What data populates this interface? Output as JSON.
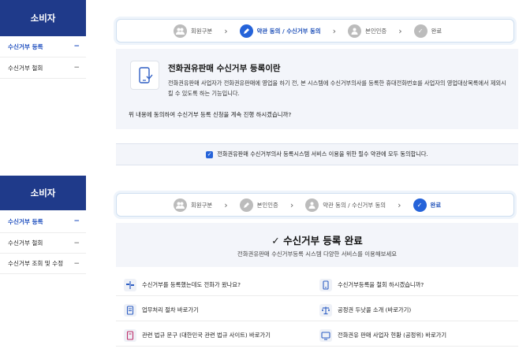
{
  "colors": {
    "brand": "#1f3a8a",
    "accent": "#2563d9",
    "panel": "#f3f5fa"
  },
  "top": {
    "sidebar": {
      "title": "소비자",
      "items": [
        {
          "label": "수신거부 등록",
          "marker": "−",
          "active": true
        },
        {
          "label": "수신거부 철회",
          "marker": "−",
          "active": false
        }
      ]
    },
    "steps": [
      {
        "label": "회원구분",
        "icon": "users-icon"
      },
      {
        "label": "약관 동의 / 수신거부 동의",
        "icon": "pencil-icon",
        "active": true
      },
      {
        "label": "본인인증",
        "icon": "person-icon"
      },
      {
        "label": "완료",
        "icon": "check-icon"
      }
    ],
    "intro": {
      "icon": "phone-icon",
      "title": "전화권유판매 수신거부 등록이란",
      "desc": "전화권유판매 사업자가 전화권유판매에 영업을 하기 전, 본 시스템에 수신거부의사를 등록한 휴대전화번호를 사업자의 영업대상목록에서 제외시킬 수 있도록 하는 기능입니다.",
      "question": "위 내용에 동의하여 수신거부 등록 신청을 계속 진행 하시겠습니까?"
    },
    "agree_label": "전화권유판매 수신거부의사 등록시스템 서비스 이용을 위한 필수 약관에 모두 동의합니다."
  },
  "bottom": {
    "sidebar": {
      "title": "소비자",
      "items": [
        {
          "label": "수신거부 등록",
          "marker": "−",
          "active": true
        },
        {
          "label": "수신거부 철회",
          "marker": "−",
          "active": false
        },
        {
          "label": "수신거부 조회 및 수정",
          "marker": "−",
          "active": false
        }
      ]
    },
    "steps": [
      {
        "label": "회원구분",
        "icon": "users-icon"
      },
      {
        "label": "본인인증",
        "icon": "pencil-icon"
      },
      {
        "label": "약관 동의 / 수신거부 동의",
        "icon": "person-icon"
      },
      {
        "label": "완료",
        "icon": "check-icon",
        "active": true
      }
    ],
    "done": {
      "title": "수신거부 등록 완료",
      "subtitle": "전화권유판매 수신거부등록 시스템 다양한 서비스를 이용해보세요"
    },
    "links": [
      {
        "label": "수신거부를 등록했는데도 전화가 왔나요?",
        "icon": "signpost-icon"
      },
      {
        "label": "수신거부등록을 철회 하시겠습니까?",
        "icon": "phone-icon"
      },
      {
        "label": "업무처리 절차 바로가기",
        "icon": "document-icon"
      },
      {
        "label": "공정권 두낫콜 소개 (바로가기)",
        "icon": "scale-icon"
      },
      {
        "label": "관련 법규 문구 (대한민국 관련 법규 사이트) 바로가기",
        "icon": "book-icon"
      },
      {
        "label": "전화권유 판매 사업자 현황 (공정위) 바로가기",
        "icon": "monitor-icon"
      }
    ]
  }
}
